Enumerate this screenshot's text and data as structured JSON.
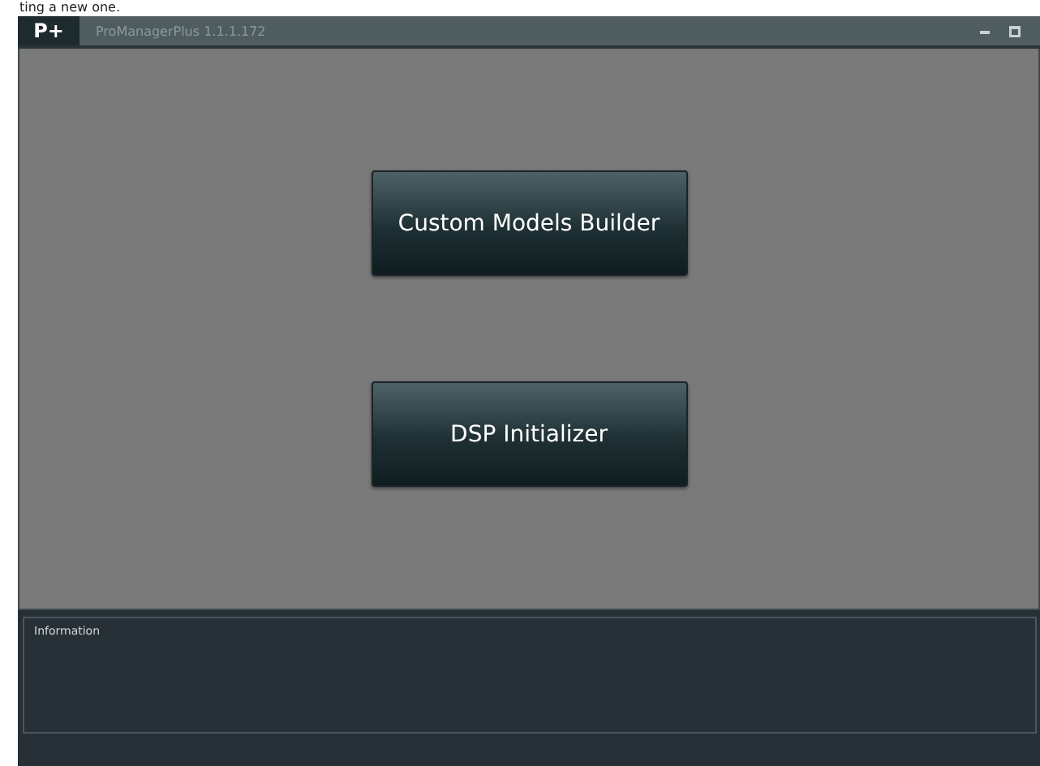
{
  "page_caption": "ting a new one.",
  "window": {
    "logo": "P+",
    "title": "ProManagerPlus 1.1.1.172"
  },
  "buttons": [
    {
      "label": "Custom Models Builder"
    },
    {
      "label": "DSP Initializer"
    }
  ],
  "information_panel": {
    "title": "Information"
  }
}
